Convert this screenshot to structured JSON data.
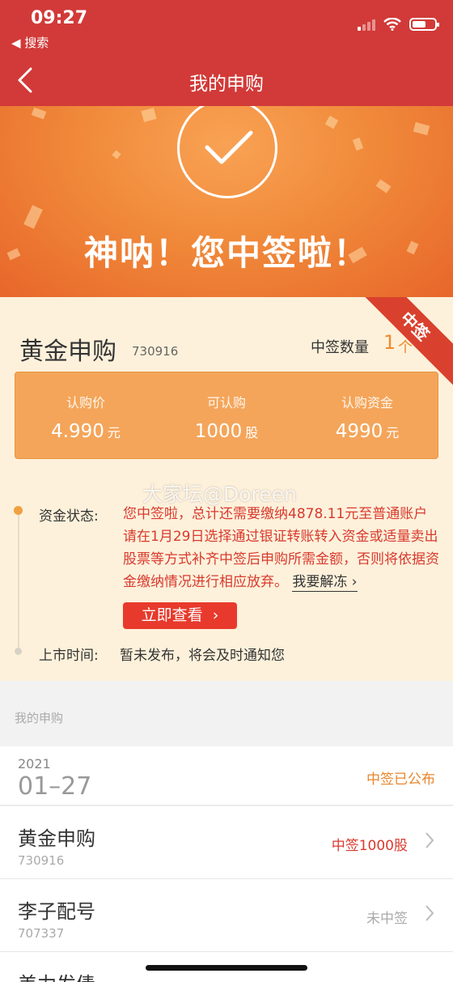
{
  "status_bar": {
    "time": "09:27",
    "back_app": "◀ 搜索"
  },
  "nav": {
    "title": "我的申购"
  },
  "banner": {
    "title": "神呐！您中签啦！"
  },
  "card": {
    "ribbon": "中签",
    "stock_name": "黄金申购",
    "stock_code": "730916",
    "win_label": "中签数量",
    "win_count": "1",
    "win_unit": "个",
    "stats": [
      {
        "label": "认购价",
        "value": "4.990",
        "unit": "元"
      },
      {
        "label": "可认购",
        "value": "1000",
        "unit": "股"
      },
      {
        "label": "认购资金",
        "value": "4990",
        "unit": "元"
      }
    ],
    "fund_status_label": "资金状态:",
    "fund_status_text": "您中签啦，总计还需要缴纳4878.11元至普通账户请在1月29日选择通过银证转账转入资金或适量卖出股票等方式补齐中签后申购所需金额，否则将依据资金缴纳情况进行相应放弃。",
    "unfreeze_link": "我要解冻",
    "view_button": "立即查看",
    "listing_label": "上市时间:",
    "listing_text": "暂未发布，将会及时通知您",
    "watermark": "大家坛@Doreen"
  },
  "history": {
    "section_title": "我的申购",
    "date_year": "2021",
    "date_md": "01–27",
    "date_status": "中签已公布",
    "items": [
      {
        "name": "黄金申购",
        "code": "730916",
        "status": "中签1000股",
        "status_color": "#d93a2e"
      },
      {
        "name": "李子配号",
        "code": "707337",
        "status": "未中签",
        "status_color": "#aaaaaa"
      },
      {
        "name": "美力发债",
        "code": "",
        "status": "",
        "status_color": "#aaaaaa"
      }
    ]
  },
  "colors": {
    "nav_red": "#d13a38",
    "accent_orange": "#f08a2a",
    "button_red": "#e83a2c"
  }
}
